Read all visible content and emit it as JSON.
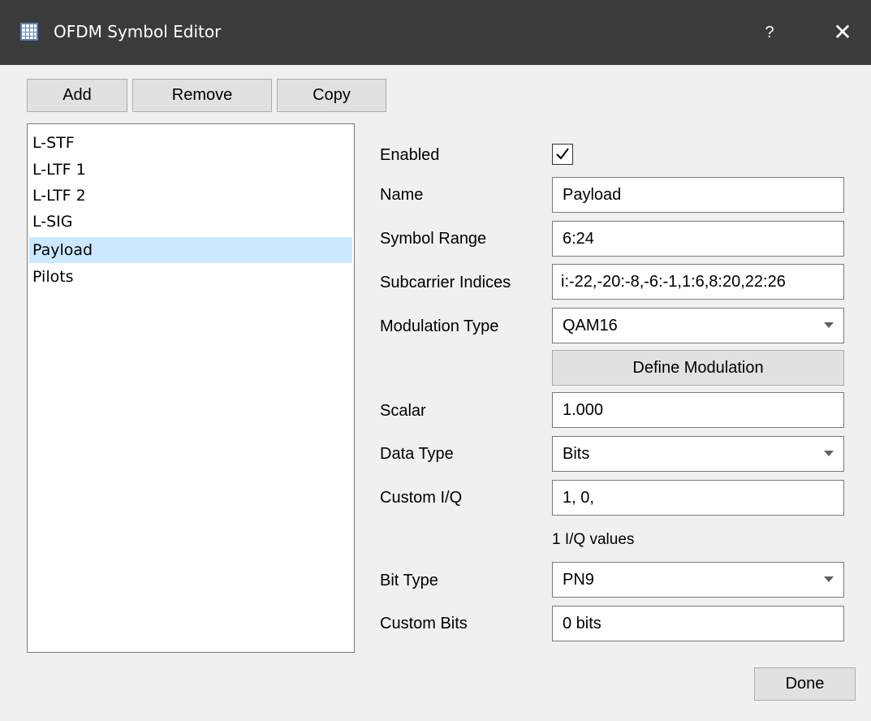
{
  "window": {
    "title": "OFDM Symbol Editor",
    "help_label": "?",
    "close_label": "✕"
  },
  "toolbar": {
    "add_label": "Add",
    "remove_label": "Remove",
    "copy_label": "Copy"
  },
  "symbols": [
    "L-STF",
    "L-LTF 1",
    "L-LTF 2",
    "L-SIG",
    "Payload",
    "Pilots"
  ],
  "selected_symbol": "Payload",
  "form": {
    "enabled_label": "Enabled",
    "enabled": true,
    "name_label": "Name",
    "name_value": "Payload",
    "symbol_range_label": "Symbol Range",
    "symbol_range_value": "6:24",
    "subcarrier_label": "Subcarrier Indices",
    "subcarrier_value": "i:-22,-20:-8,-6:-1,1:6,8:20,22:26",
    "modulation_label": "Modulation Type",
    "modulation_value": "QAM16",
    "define_modulation_label": "Define Modulation",
    "scalar_label": "Scalar",
    "scalar_value": "1.000",
    "data_type_label": "Data Type",
    "data_type_value": "Bits",
    "custom_iq_label": "Custom I/Q",
    "custom_iq_value": "1, 0,",
    "iq_count_text": "1 I/Q values",
    "bit_type_label": "Bit Type",
    "bit_type_value": "PN9",
    "custom_bits_label": "Custom Bits",
    "custom_bits_value": "0 bits"
  },
  "footer": {
    "done_label": "Done"
  }
}
